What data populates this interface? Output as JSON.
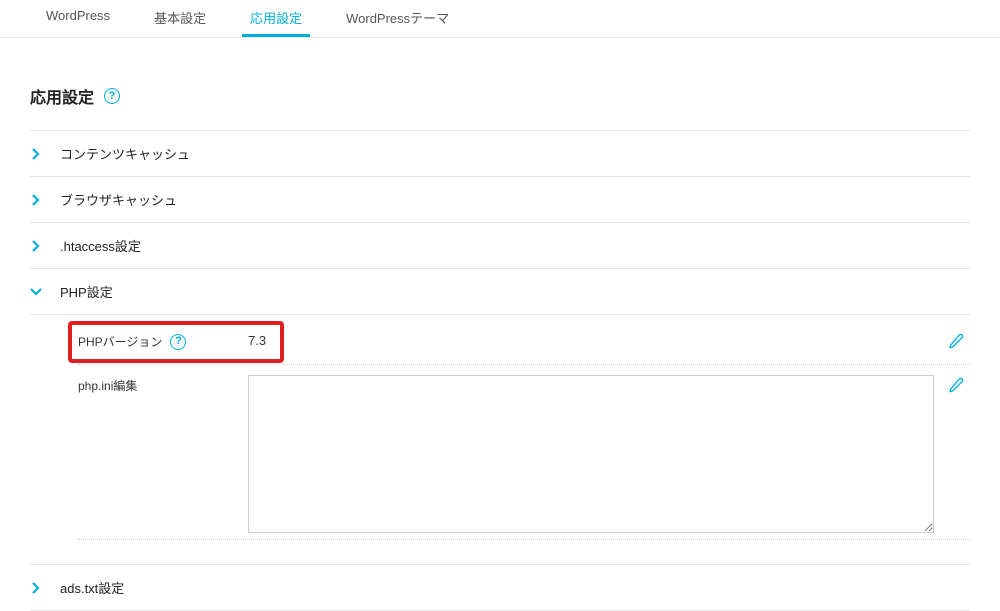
{
  "tabs": {
    "items": [
      {
        "label": "WordPress",
        "active": false
      },
      {
        "label": "基本設定",
        "active": false
      },
      {
        "label": "応用設定",
        "active": true
      },
      {
        "label": "WordPressテーマ",
        "active": false
      }
    ]
  },
  "page_title": "応用設定",
  "accordion": {
    "content_cache": {
      "label": "コンテンツキャッシュ"
    },
    "browser_cache": {
      "label": "ブラウザキャッシュ"
    },
    "htaccess": {
      "label": ".htaccess設定"
    },
    "php": {
      "label": "PHP設定"
    },
    "ads_txt": {
      "label": "ads.txt設定"
    }
  },
  "php_settings": {
    "version_label": "PHPバージョン",
    "version_value": "7.3",
    "phpini_label": "php.ini編集",
    "phpini_value": ""
  },
  "colors": {
    "accent": "#00aee0",
    "highlight": "#e02020"
  }
}
